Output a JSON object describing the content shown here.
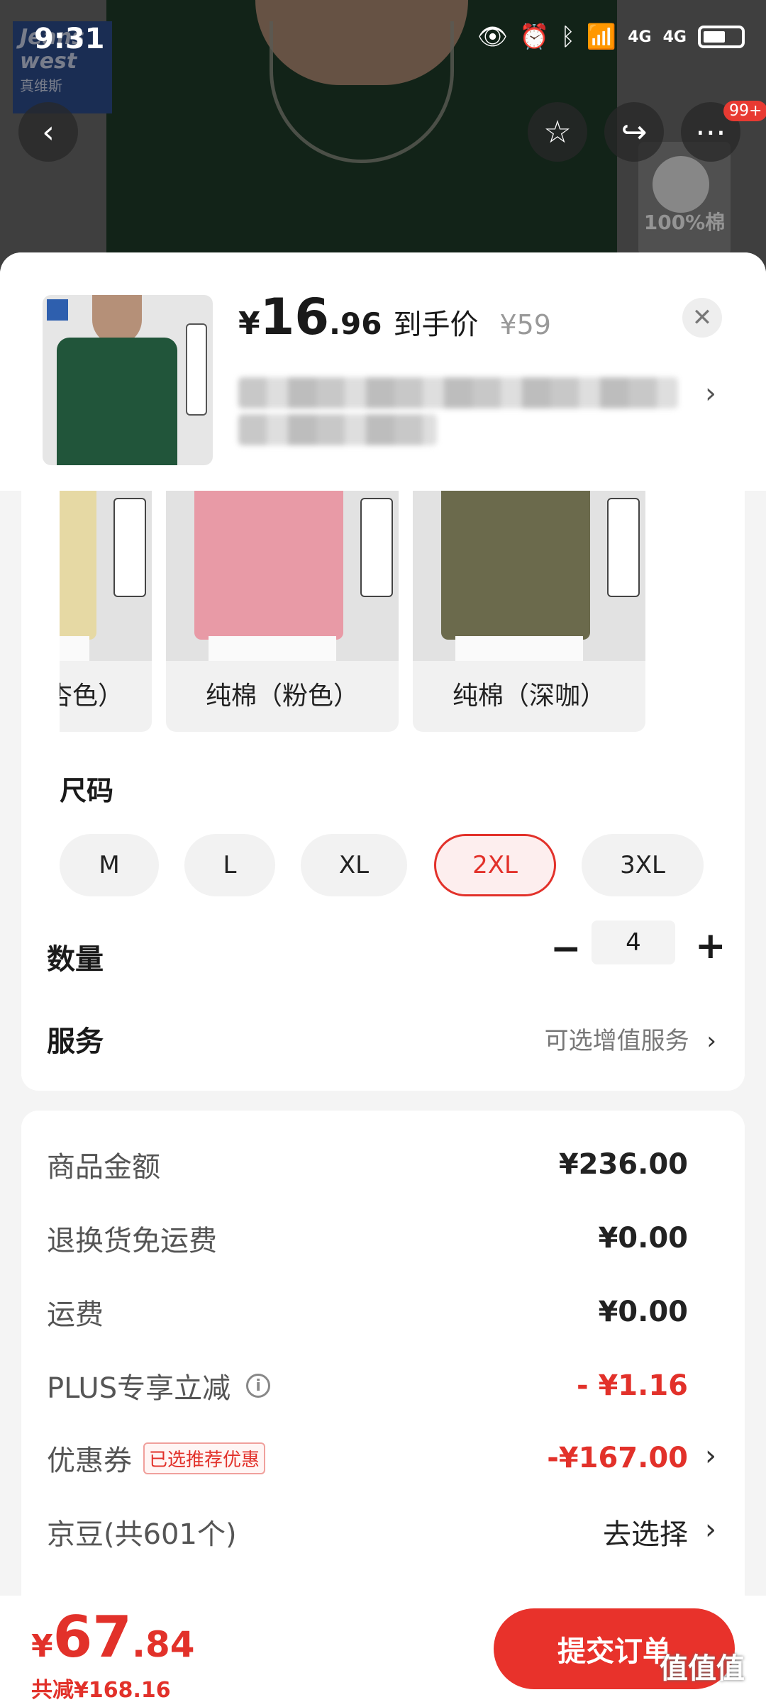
{
  "status_bar": {
    "time": "9:31",
    "signal_1": "4G",
    "signal_2": "4G"
  },
  "brand": {
    "name": "Jeans west",
    "cn": "真维斯"
  },
  "nav": {
    "more_badge": "99+"
  },
  "product_image_badge": "100%棉",
  "header": {
    "currency": "¥",
    "price_int": "16",
    "price_dec": ".96",
    "price_label": "到手价",
    "original_price": "¥59"
  },
  "colors": [
    {
      "name": "纯棉（杏色）",
      "swatch": "#e6d9a4"
    },
    {
      "name": "纯棉（粉色）",
      "swatch": "#e89aa6"
    },
    {
      "name": "纯棉（深咖）",
      "swatch": "#6b6a4c"
    }
  ],
  "size": {
    "title": "尺码",
    "options": [
      "M",
      "L",
      "XL",
      "2XL",
      "3XL"
    ],
    "selected": "2XL"
  },
  "quantity": {
    "title": "数量",
    "value": "4"
  },
  "service": {
    "title": "服务",
    "value": "可选增值服务"
  },
  "summary": {
    "goods_label": "商品金额",
    "goods_value": "¥236.00",
    "return_label": "退换货免运费",
    "return_value": "¥0.00",
    "shipping_label": "运费",
    "shipping_value": "¥0.00",
    "plus_label": "PLUS专享立减",
    "plus_value": "- ¥1.16",
    "coupon_label": "优惠券",
    "coupon_tag": "已选推荐优惠",
    "coupon_value": "-¥167.00",
    "jd_label": "京豆(共601个)",
    "jd_value": "去选择"
  },
  "footer": {
    "total_currency": "¥",
    "total_int": "67",
    "total_dec": ".84",
    "total_save": "共减¥168.16",
    "submit_label": "提交订单"
  },
  "watermark": "值值值",
  "colors_theme": {
    "accent": "#e2312a",
    "background": "#f4f4f4"
  }
}
